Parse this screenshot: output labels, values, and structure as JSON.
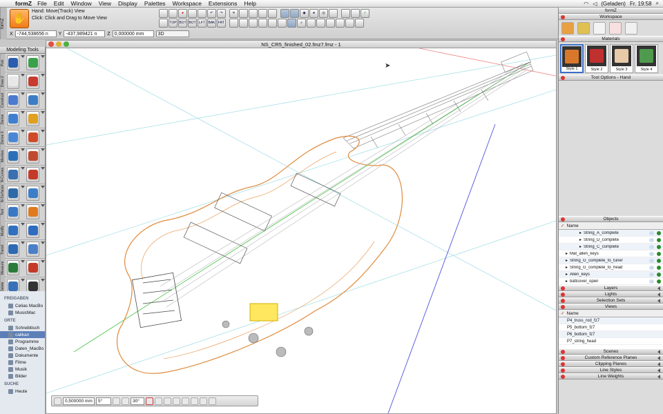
{
  "menubar": {
    "app": "formZ",
    "items": [
      "File",
      "Edit",
      "Window",
      "View",
      "Display",
      "Palettes",
      "Workspace",
      "Extensions",
      "Help"
    ],
    "status": "(Geladen)",
    "clock": "Fr. 19:58"
  },
  "toolbar": {
    "vertical_label": "formZ",
    "tool_name": "Hand:",
    "tool_action": "Move(Track) View",
    "hint": "Click: Click and Drag to Move View",
    "x_label": "X",
    "x_value": "-744,538656 n",
    "y_label": "Y",
    "y_value": "-437,989421 n",
    "z_label": "Z",
    "z_value": "0,000000 mm",
    "view_mode": "3D",
    "view_buttons": [
      "TOP",
      "BOT",
      "BOT",
      "LFT",
      "BAK",
      "FRT"
    ]
  },
  "document": {
    "title": "NS_CR5_finished_02.fmz7.fmz - 1"
  },
  "modeling_tools": {
    "title": "Modeling Tools",
    "rows": [
      {
        "label": "Pick",
        "c1": "#2a5db0",
        "c2": "#3aa14a"
      },
      {
        "label": "Draw 2",
        "c1": "#e8e8e8",
        "c2": "#c63b2e"
      },
      {
        "label": "Construct",
        "c1": "#4a7bd0",
        "c2": "#3c7dc7"
      },
      {
        "label": "Derive",
        "c1": "#3f7fd0",
        "c2": "#e0a020"
      },
      {
        "label": "Derive II",
        "c1": "#4b86d4",
        "c2": "#d04a2a"
      },
      {
        "label": "Meshes",
        "c1": "#2b6fb8",
        "c2": "#c04a30"
      },
      {
        "label": "N-Curves",
        "c1": "#3a6fb2",
        "c2": "#c33a2a"
      },
      {
        "label": "N-Surfaces",
        "c1": "#2e6aa8",
        "c2": "#3c7ec8"
      },
      {
        "label": "Text",
        "c1": "#3a78c4",
        "c2": "#e07a20"
      },
      {
        "label": "Modify",
        "c1": "#3070c0",
        "c2": "#2f6cc0"
      },
      {
        "label": "Transf.",
        "c1": "#2d6ab4",
        "c2": "#4b80c8"
      },
      {
        "label": "Measure",
        "c1": "#2a7a3a",
        "c2": "#c43a2a"
      },
      {
        "label": "Delete",
        "c1": "#3a70b8",
        "c2": "#333333"
      }
    ]
  },
  "finder": {
    "sections": [
      {
        "header": "FREIGABEN",
        "items": [
          "Celias MacBo",
          "MusicMac"
        ]
      },
      {
        "header": "ORTE",
        "items": [
          "Schreibtisch",
          "calikan",
          "Programme",
          "Daten_MacBo",
          "Dokumente",
          "Filme",
          "Musik",
          "Bilder"
        ]
      },
      {
        "header": "SUCHE",
        "items": [
          "Heute"
        ]
      }
    ],
    "selected": "calikan"
  },
  "bottom_toolbar": {
    "length": "0,500000 mm",
    "angle1": "5°",
    "angle2": "30°"
  },
  "right_panel": {
    "title": "formZ",
    "workspace": "Workspace",
    "materials": {
      "title": "Materials",
      "items": [
        {
          "name": "Style 1",
          "color": "#d9782a"
        },
        {
          "name": "Style 2",
          "color": "#c0302e"
        },
        {
          "name": "Style 3",
          "color": "#e8c9a8"
        },
        {
          "name": "Style 4",
          "color": "#4f9a4f"
        }
      ]
    },
    "tool_options": "Tool Options - Hand",
    "objects": {
      "title": "Objects",
      "column": "Name",
      "rows": [
        "String_A_complete",
        "String_D_complete",
        "String_C_complete",
        "Mat_allen_keys",
        "String_G_complete_to_tuner",
        "String_G_complete_to_head",
        "Allen_keys",
        "battcover_open"
      ]
    },
    "collapsed_a": [
      "Layers",
      "Lights",
      "Selection Sets"
    ],
    "views": {
      "title": "Views",
      "column": "Name",
      "rows": [
        "P4_truss_rod_fz7",
        "P5_bottom_fz7",
        "P6_bottom_fz7",
        "P7_string_head"
      ]
    },
    "collapsed_b": [
      "Scenes",
      "Custom Reference Planes",
      "Clipping Planes",
      "Line Styles",
      "Line Weights"
    ]
  }
}
